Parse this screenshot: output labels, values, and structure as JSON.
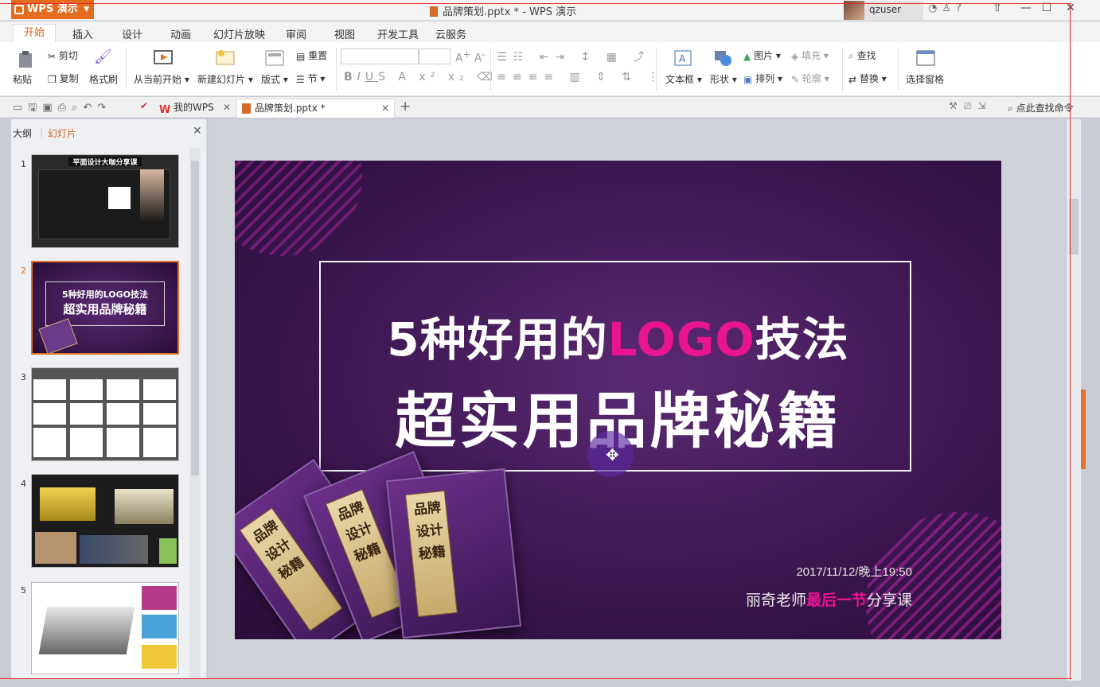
{
  "app": {
    "name": "WPS 演示",
    "doc_title": "品牌策划.pptx * - WPS 演示",
    "user": "qzuser"
  },
  "ribbon_tabs": [
    "开始",
    "插入",
    "设计",
    "动画",
    "幻灯片放映",
    "审阅",
    "视图",
    "开发工具",
    "云服务"
  ],
  "ribbon": {
    "paste": "粘贴",
    "cut": "剪切",
    "copy": "复制",
    "format_painter": "格式刷",
    "from_current": "从当前开始",
    "new_slide": "新建幻灯片",
    "layout": "版式",
    "reset": "重置",
    "section": "节",
    "textbox": "文本框",
    "shape": "形状",
    "picture": "图片",
    "arrange": "排列",
    "fill": "填充",
    "outline": "轮廓",
    "find": "查找",
    "replace": "替换",
    "select_pane": "选择窗格"
  },
  "doc_tabs": [
    {
      "label": "我的WPS"
    },
    {
      "label": "品牌策划.pptx *"
    }
  ],
  "search_cmd": "点此查找命令",
  "left_panel": {
    "tab_outline": "大纲",
    "tab_slides": "幻灯片"
  },
  "thumbnails": [
    {
      "num": "1",
      "title": "平面设计大咖分享课"
    },
    {
      "num": "2",
      "line1": "5种好用的LOGO技法",
      "line2": "超实用品牌秘籍"
    },
    {
      "num": "3"
    },
    {
      "num": "4"
    },
    {
      "num": "5"
    }
  ],
  "slide": {
    "title_part1": "5种好用的",
    "title_highlight": "LOGO",
    "title_part2": "技法",
    "subtitle": "超实用品牌秘籍",
    "date": "2017/11/12/晚上19:50",
    "teacher_pre": "丽奇老师",
    "teacher_highlight": "最后一节",
    "teacher_post": "分享课",
    "book_text": "品牌设计秘籍"
  }
}
